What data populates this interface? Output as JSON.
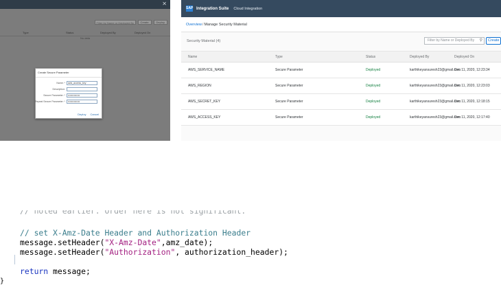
{
  "left_dialog_screen": {
    "filter_placeholder": "Filter by Name or Deployed By",
    "create_label": "Create",
    "deploy_label": "Deploy",
    "columns": [
      "Type",
      "Status",
      "Deployed By",
      "Deployed On"
    ],
    "empty_text": "No data",
    "dialog": {
      "title": "Create Secure Parameter",
      "fields": [
        {
          "label": "Name: *",
          "value": "aws_access_key"
        },
        {
          "label": "Description:",
          "value": ""
        },
        {
          "label": "Secure Parameter: *",
          "value": "••••••••••••••"
        },
        {
          "label": "Repeat Secure Parameter: *",
          "value": "••••••••••••••"
        }
      ],
      "deploy_button": "Deploy",
      "cancel_button": "Cancel"
    }
  },
  "sap": {
    "product": "Integration Suite",
    "area": "Cloud Integration",
    "breadcrumb": {
      "overview": "Overview",
      "sep": "/",
      "current": "Manage Security Material"
    },
    "table_title": "Security Material (4)",
    "search_placeholder": "Filter by Name or Deployed By",
    "create_label": "Create",
    "columns": {
      "name": "Name",
      "type": "Type",
      "status": "Status",
      "deployed_by": "Deployed By",
      "deployed_on": "Deployed On"
    },
    "rows": [
      {
        "name": "AWS_SERVICE_NAME",
        "type": "Secure Parameter",
        "status": "Deployed",
        "deployed_by": "karthikeyansuresh23@gmail.com",
        "deployed_on": "Dec 11, 2020, 12:23:34"
      },
      {
        "name": "AWS_REGION",
        "type": "Secure Parameter",
        "status": "Deployed",
        "deployed_by": "karthikeyansuresh23@gmail.com",
        "deployed_on": "Dec 11, 2020, 12:23:03"
      },
      {
        "name": "AWS_SECRET_KEY",
        "type": "Secure Parameter",
        "status": "Deployed",
        "deployed_by": "karthikeyansuresh23@gmail.com",
        "deployed_on": "Dec 11, 2020, 12:18:15"
      },
      {
        "name": "AWS_ACCESS_KEY",
        "type": "Secure Parameter",
        "status": "Deployed",
        "deployed_by": "karthikeyansuresh23@gmail.com",
        "deployed_on": "Dec 11, 2020, 12:17:40"
      }
    ]
  },
  "code": {
    "faded_line": "// noted earlier. Order here is not significant.",
    "comment_line": "// set X-Amz-Date Header and Authorization Header",
    "line2_prefix": "message.setHeader(",
    "line2_string": "\"X-Amz-Date\"",
    "line2_suffix": ",amz_date);",
    "line3_prefix": "message.setHeader(",
    "line3_string": "\"Authorization\"",
    "line3_suffix": ", authorization_header);",
    "return_kw": "return",
    "return_rest": " message;",
    "closing_brace": "}"
  }
}
